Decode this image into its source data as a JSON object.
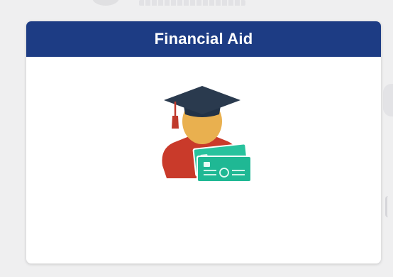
{
  "tile": {
    "title": "Financial Aid",
    "icon": "graduate-with-financial-cards-icon"
  },
  "colors": {
    "header_bg": "#1d3c84",
    "header_text": "#ffffff",
    "page_bg": "#efeff0",
    "cap": "#2a3a4e",
    "tassel": "#c0392b",
    "face": "#e9b04f",
    "robe": "#c93a2a",
    "card": "#1fb894",
    "card_light": "#8fe3cc"
  }
}
